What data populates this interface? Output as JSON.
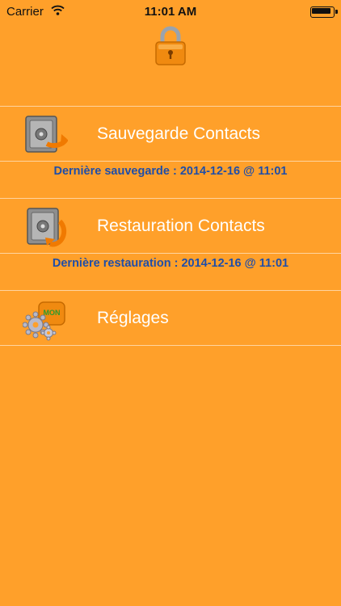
{
  "status_bar": {
    "carrier": "Carrier",
    "time": "11:01 AM"
  },
  "header": {
    "icon": "padlock-icon"
  },
  "menu": {
    "backup": {
      "label": "Sauvegarde Contacts",
      "icon": "safe-icon",
      "last_text": "Dernière sauvegarde : 2014-12-16 @ 11:01"
    },
    "restore": {
      "label": "Restauration Contacts",
      "icon": "safe-icon",
      "last_text": "Dernière restauration : 2014-12-16 @ 11:01"
    },
    "settings": {
      "label": "Réglages",
      "icon": "settings-gears-icon",
      "icon_badge_text": "MON"
    }
  },
  "colors": {
    "background": "#FFA02A",
    "info_text": "#1F4EA8",
    "label_text": "#FFFFFF"
  }
}
